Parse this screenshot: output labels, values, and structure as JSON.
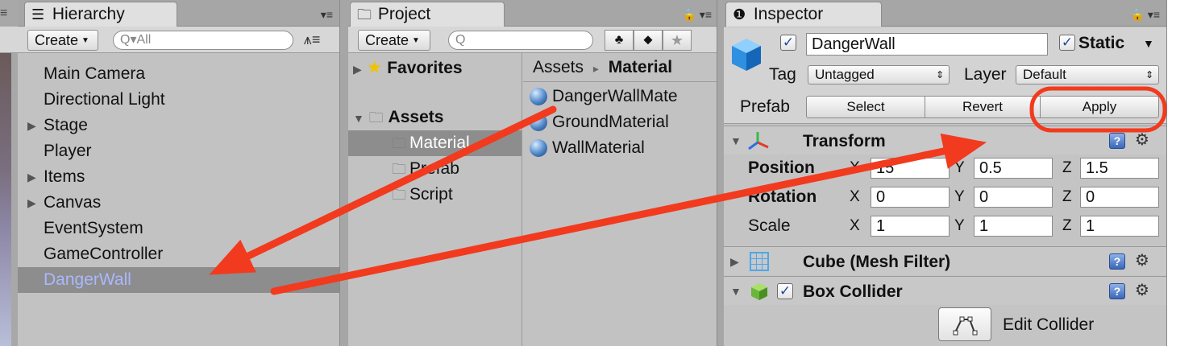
{
  "hierarchy": {
    "tab_label": "Hierarchy",
    "menu_glyph": "▾≡",
    "create_label": "Create",
    "search_placeholder": "Q▾All",
    "items": [
      {
        "label": "Main Camera",
        "expandable": false
      },
      {
        "label": "Directional Light",
        "expandable": false
      },
      {
        "label": "Stage",
        "expandable": true
      },
      {
        "label": "Player",
        "expandable": false
      },
      {
        "label": "Items",
        "expandable": true
      },
      {
        "label": "Canvas",
        "expandable": true
      },
      {
        "label": "EventSystem",
        "expandable": false
      },
      {
        "label": "GameController",
        "expandable": false
      },
      {
        "label": "DangerWall",
        "expandable": false,
        "selected": true
      }
    ]
  },
  "project": {
    "tab_label": "Project",
    "create_label": "Create",
    "search_placeholder": "Q",
    "favorites_label": "Favorites",
    "assets_label": "Assets",
    "folders": [
      {
        "label": "Material",
        "selected": true
      },
      {
        "label": "Prefab",
        "selected": false
      },
      {
        "label": "Script",
        "selected": false
      }
    ],
    "breadcrumb": {
      "root": "Assets",
      "separator": "▸",
      "current": "Material"
    },
    "assets": [
      "DangerWallMate",
      "GroundMaterial",
      "WallMaterial"
    ]
  },
  "inspector": {
    "tab_label": "Inspector",
    "object_name": "DangerWall",
    "static_label": "Static",
    "tag_label": "Tag",
    "tag_value": "Untagged",
    "layer_label": "Layer",
    "layer_value": "Default",
    "prefab_label": "Prefab",
    "prefab_buttons": {
      "select": "Select",
      "revert": "Revert",
      "apply": "Apply"
    },
    "transform": {
      "title": "Transform",
      "position_label": "Position",
      "rotation_label": "Rotation",
      "scale_label": "Scale",
      "position": {
        "x": "15",
        "y": "0.5",
        "z": "1.5"
      },
      "rotation": {
        "x": "0",
        "y": "0",
        "z": "0"
      },
      "scale": {
        "x": "1",
        "y": "1",
        "z": "1"
      },
      "axes": {
        "x": "X",
        "y": "Y",
        "z": "Z"
      }
    },
    "mesh_filter_title": "Cube (Mesh Filter)",
    "box_collider_title": "Box Collider",
    "edit_collider_label": "Edit Collider"
  },
  "colors": {
    "annotation_red": "#f23a1e",
    "selection_text": "#aab8ff",
    "selected_row": "#8d8d8d"
  }
}
